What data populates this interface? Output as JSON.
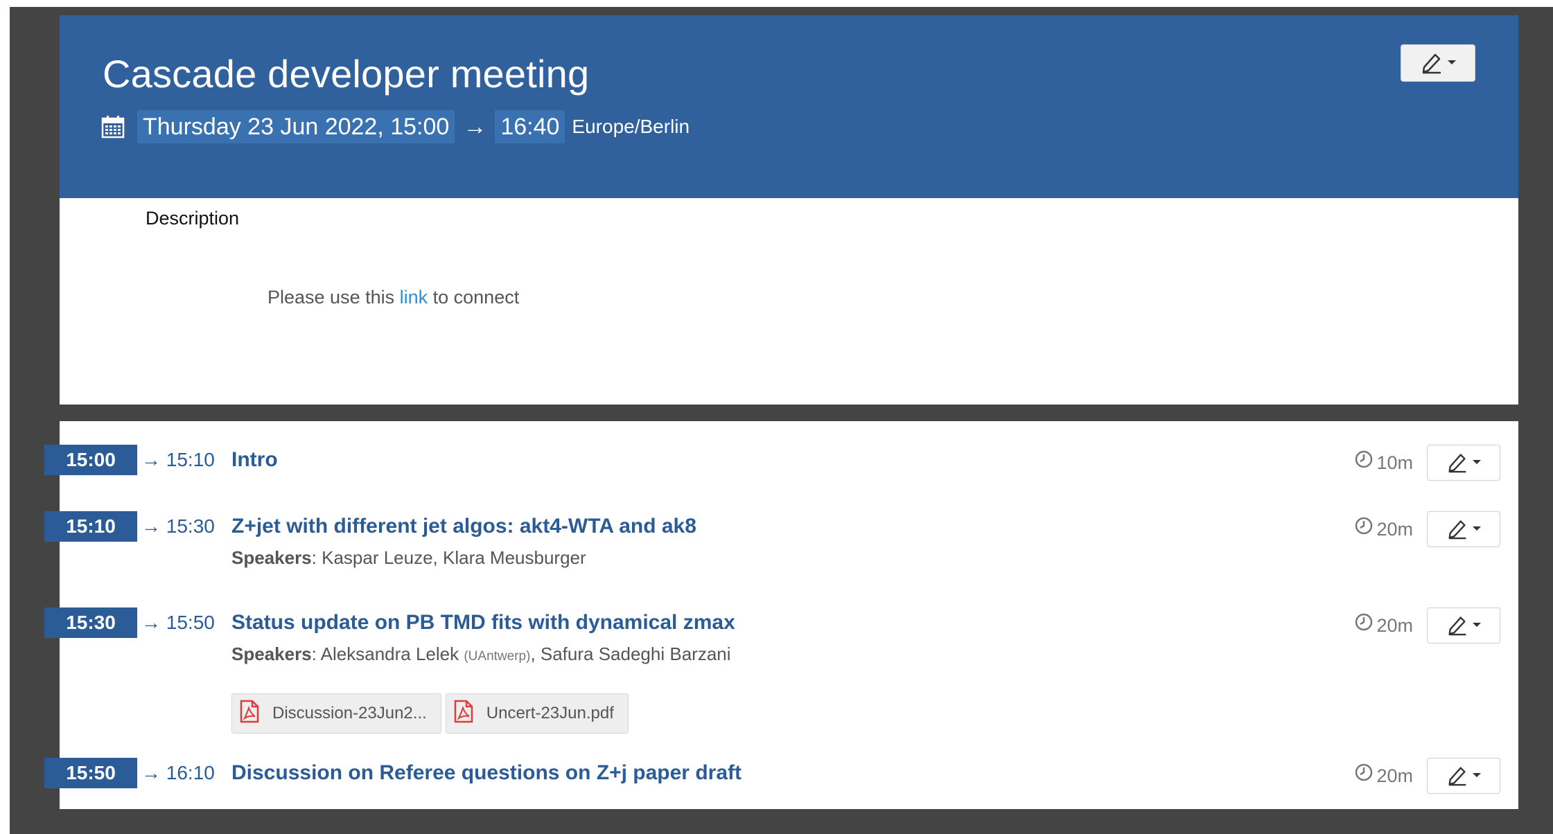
{
  "event": {
    "title": "Cascade developer meeting",
    "start": "Thursday 23 Jun 2022, 15:00",
    "arrow": "→",
    "end": "16:40",
    "timezone": "Europe/Berlin"
  },
  "description": {
    "label": "Description",
    "text_before": "Please use this ",
    "link_text": "link",
    "text_after": " to connect"
  },
  "contributions": [
    {
      "start": "15:00",
      "end": "→ 15:10",
      "title": "Intro",
      "duration": "10m"
    },
    {
      "start": "15:10",
      "end": "→ 15:30",
      "title": "Z+jet with different jet algos: akt4-WTA and ak8",
      "speakers_label": "Speakers",
      "speakers": ": Kaspar Leuze, Klara Meusburger",
      "duration": "20m"
    },
    {
      "start": "15:30",
      "end": "→ 15:50",
      "title": "Status update on PB TMD fits with dynamical zmax",
      "speakers_label": "Speakers",
      "speaker1": ": Aleksandra Lelek ",
      "speaker1_affil": "(UAntwerp)",
      "speaker2": ", Safura Sadeghi Barzani",
      "duration": "20m",
      "attachments": [
        "Discussion-23Jun2...",
        "Uncert-23Jun.pdf"
      ]
    },
    {
      "start": "15:50",
      "end": "→ 16:10",
      "title": "Discussion on Referee questions on Z+j paper draft",
      "duration": "20m"
    }
  ],
  "colors": {
    "header_bg": "#30619c",
    "accent": "#2b5c98",
    "link": "#2f8fd0",
    "pdf_icon": "#e03a3a"
  },
  "icons": {
    "date": "calendar-icon",
    "edit": "pencil-icon",
    "dropdown": "caret-down-icon",
    "duration": "clock-icon",
    "attachment": "pdf-file-icon"
  }
}
